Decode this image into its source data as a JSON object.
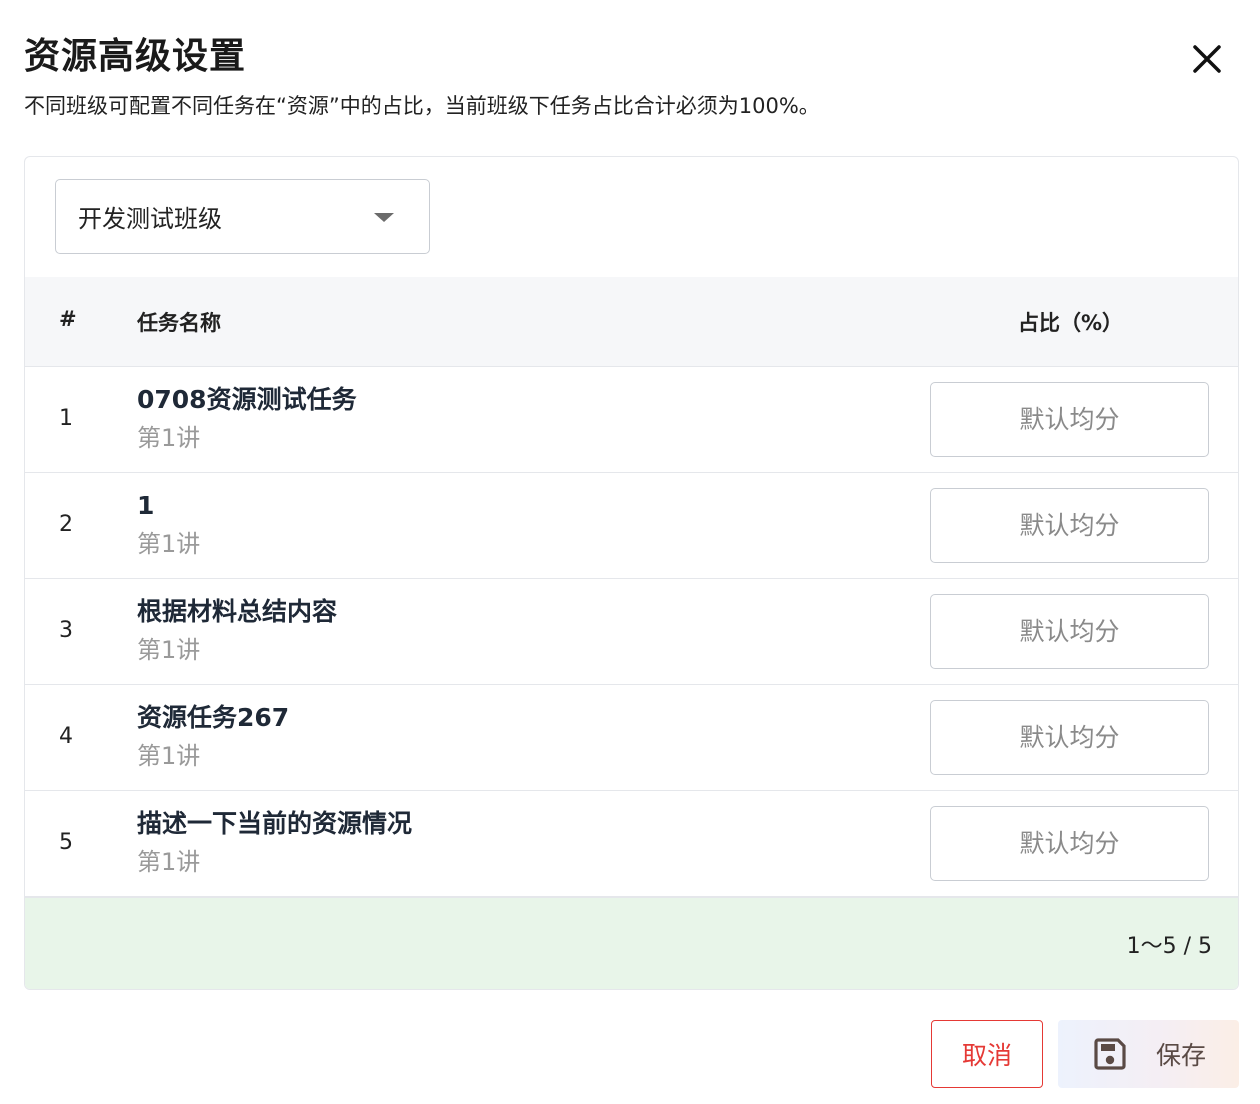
{
  "dialog": {
    "title": "资源高级设置",
    "subtitle": "不同班级可配置不同任务在“资源”中的占比，当前班级下任务占比合计必须为100%。"
  },
  "class_select": {
    "value": "开发测试班级"
  },
  "table": {
    "headers": {
      "num": "#",
      "name": "任务名称",
      "ratio": "占比（%）"
    },
    "rows": [
      {
        "num": "1",
        "name": "0708资源测试任务",
        "sub": "第1讲",
        "placeholder": "默认均分"
      },
      {
        "num": "2",
        "name": "1",
        "sub": "第1讲",
        "placeholder": "默认均分"
      },
      {
        "num": "3",
        "name": "根据材料总结内容",
        "sub": "第1讲",
        "placeholder": "默认均分"
      },
      {
        "num": "4",
        "name": "资源任务267",
        "sub": "第1讲",
        "placeholder": "默认均分"
      },
      {
        "num": "5",
        "name": "描述一下当前的资源情况",
        "sub": "第1讲",
        "placeholder": "默认均分"
      }
    ]
  },
  "pagination": {
    "text": "1～5 / 5"
  },
  "actions": {
    "cancel_label": "取消",
    "save_label": "保存"
  },
  "colors": {
    "danger": "#e53935",
    "footer_bg": "#e8f5e9",
    "header_bg": "#f6f7f9"
  },
  "icons": {
    "close": "close-icon",
    "dropdown": "caret-down-icon",
    "save": "floppy-disk-icon"
  }
}
